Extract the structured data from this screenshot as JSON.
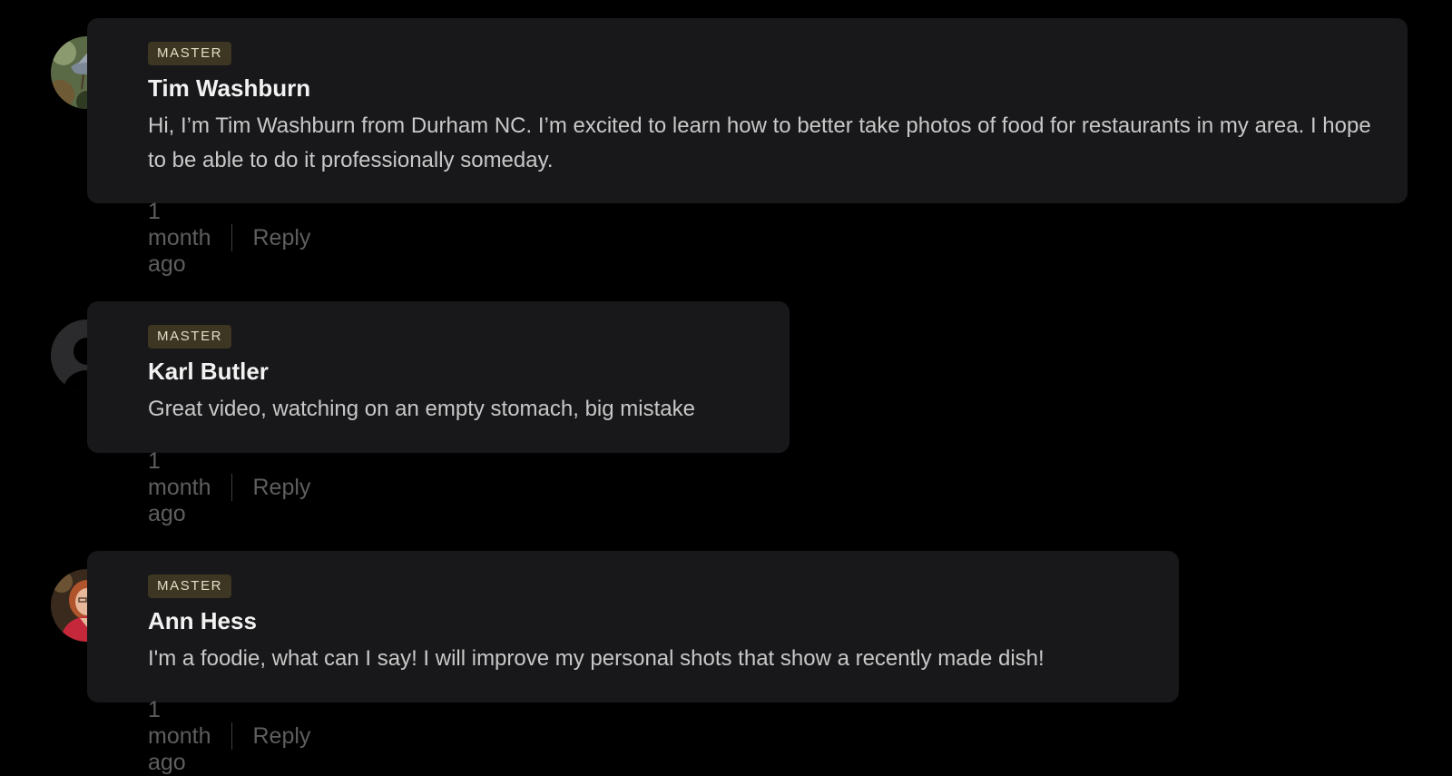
{
  "comments": [
    {
      "badge": "MASTER",
      "author": "Tim Washburn",
      "text": "Hi, I’m Tim Washburn from Durham NC. I’m excited to learn how to better take photos of food for restaurants in my area. I hope to be able to do it professionally someday.",
      "time": "1 month ago",
      "reply": "Reply",
      "avatar": "bird-photo"
    },
    {
      "badge": "MASTER",
      "author": "Karl Butler",
      "text": "Great video, watching on an empty stomach, big mistake",
      "time": "1 month ago",
      "reply": "Reply",
      "avatar": "default-user-icon"
    },
    {
      "badge": "MASTER",
      "author": "Ann Hess",
      "text": "I'm a foodie, what can I say! I will improve my personal shots that show a recently made dish!",
      "time": "1 month ago",
      "reply": "Reply",
      "avatar": "woman-photo"
    }
  ],
  "colors": {
    "background": "#000000",
    "bubble": "#18181a",
    "badge_bg": "#3d3622",
    "badge_text": "#e4dcc4",
    "meta_text": "#5e5e5e"
  }
}
